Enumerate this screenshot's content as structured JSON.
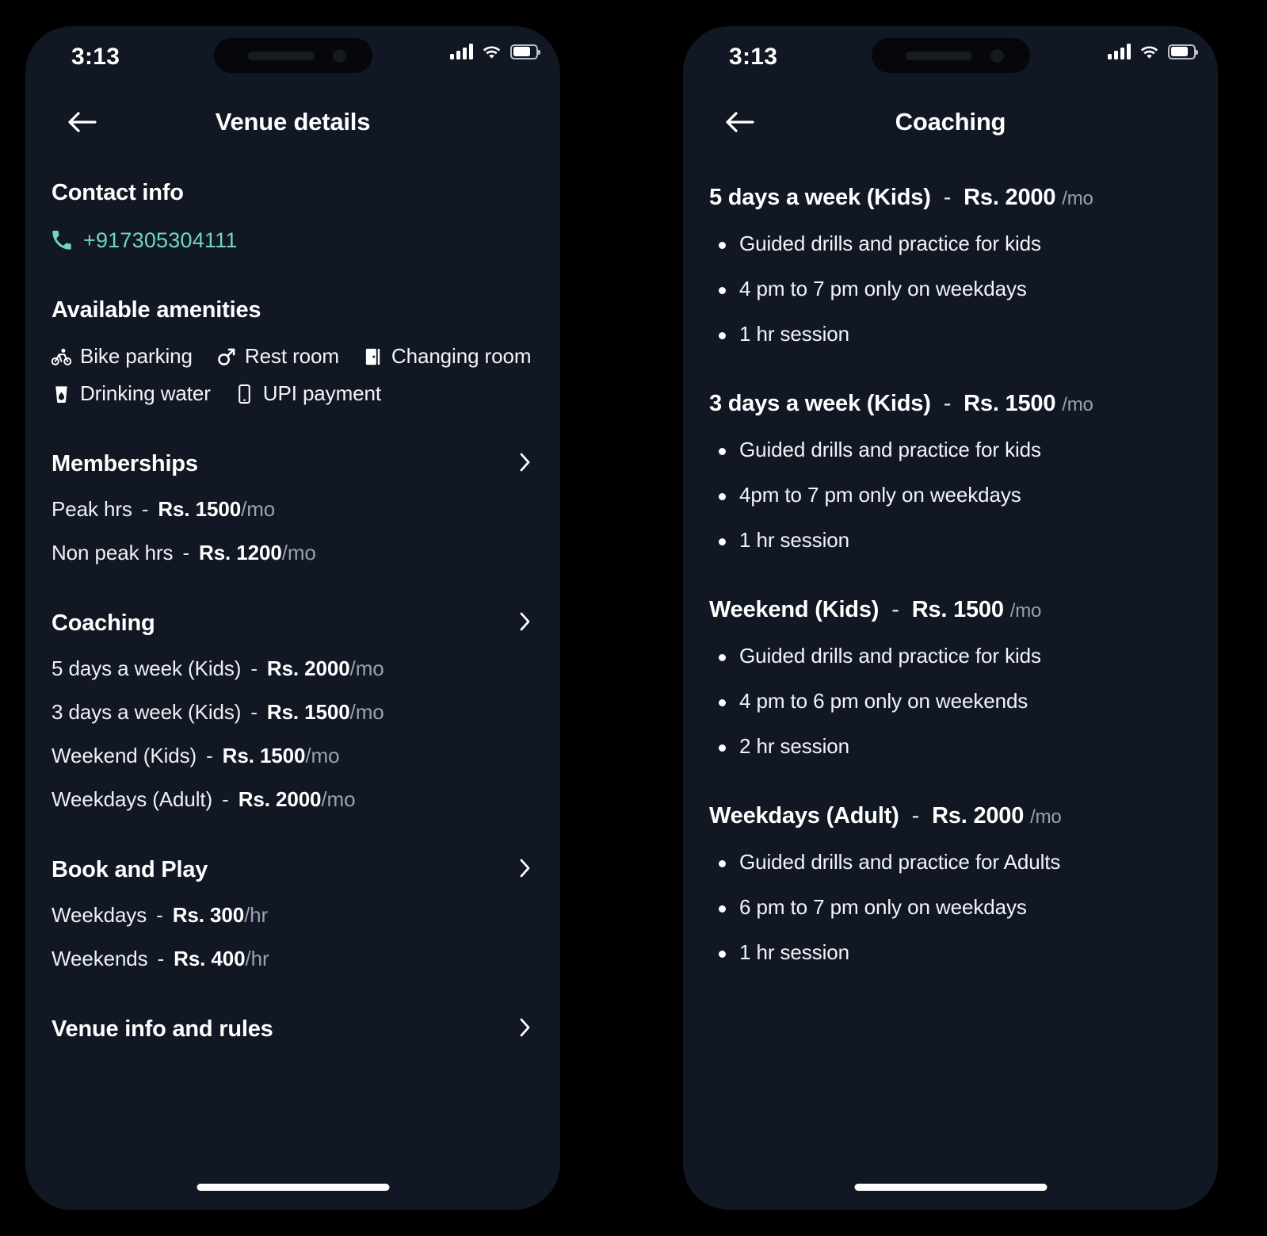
{
  "status_bar": {
    "time": "3:13",
    "signal_icon": "cellular-signal-icon",
    "wifi_icon": "wifi-icon",
    "battery_icon": "battery-icon"
  },
  "colors": {
    "screen_background": "#121724",
    "page_background": "#000000",
    "accent_teal": "#6FD6BD",
    "primary_text": "#FFFFFF",
    "muted_text": "#9AA1B0"
  },
  "venue_screen": {
    "title": "Venue details",
    "back_icon": "back-arrow-icon",
    "contact": {
      "heading": "Contact info",
      "phone_icon": "phone-icon",
      "phone_number": "+917305304111"
    },
    "amenities": {
      "heading": "Available amenities",
      "items": [
        {
          "label": "Bike parking",
          "icon": "bicycle-icon"
        },
        {
          "label": "Rest room",
          "icon": "male-restroom-icon"
        },
        {
          "label": "Changing room",
          "icon": "door-icon"
        },
        {
          "label": "Drinking water",
          "icon": "water-cup-icon"
        },
        {
          "label": "UPI payment",
          "icon": "mobile-phone-icon"
        }
      ]
    },
    "memberships": {
      "heading": "Memberships",
      "chevron_icon": "chevron-right-icon",
      "rows": [
        {
          "label": "Peak hrs",
          "dash": "-",
          "amount": "Rs. 1500",
          "per": "/mo"
        },
        {
          "label": "Non peak hrs",
          "dash": "-",
          "amount": "Rs. 1200",
          "per": "/mo"
        }
      ]
    },
    "coaching": {
      "heading": "Coaching",
      "chevron_icon": "chevron-right-icon",
      "rows": [
        {
          "label": "5 days a week (Kids)",
          "dash": "-",
          "amount": "Rs. 2000",
          "per": "/mo"
        },
        {
          "label": "3 days a week (Kids)",
          "dash": "-",
          "amount": "Rs. 1500",
          "per": "/mo"
        },
        {
          "label": "Weekend (Kids)",
          "dash": "-",
          "amount": "Rs. 1500",
          "per": "/mo"
        },
        {
          "label": "Weekdays (Adult)",
          "dash": "-",
          "amount": "Rs. 2000",
          "per": "/mo"
        }
      ]
    },
    "book_and_play": {
      "heading": "Book and Play",
      "chevron_icon": "chevron-right-icon",
      "rows": [
        {
          "label": "Weekdays",
          "dash": "-",
          "amount": "Rs. 300",
          "per": "/hr"
        },
        {
          "label": "Weekends",
          "dash": "-",
          "amount": "Rs. 400",
          "per": "/hr"
        }
      ]
    },
    "venue_info": {
      "heading": "Venue info and rules",
      "chevron_icon": "chevron-right-icon"
    }
  },
  "coaching_screen": {
    "title": "Coaching",
    "back_icon": "back-arrow-icon",
    "plans": [
      {
        "name": "5 days a week (Kids)",
        "dash": "-",
        "amount": "Rs. 2000",
        "per": "/mo",
        "bullets": [
          "Guided drills and practice for kids",
          "4 pm to 7 pm only on weekdays",
          "1 hr session"
        ]
      },
      {
        "name": "3 days a week (Kids)",
        "dash": "-",
        "amount": "Rs. 1500",
        "per": "/mo",
        "bullets": [
          "Guided drills and practice for kids",
          "4pm to 7 pm only on weekdays",
          "1 hr session"
        ]
      },
      {
        "name": "Weekend (Kids)",
        "dash": "-",
        "amount": "Rs. 1500",
        "per": "/mo",
        "bullets": [
          "Guided drills and practice for kids",
          "4 pm to 6 pm only on weekends",
          "2 hr session"
        ]
      },
      {
        "name": "Weekdays (Adult)",
        "dash": "-",
        "amount": "Rs. 2000",
        "per": "/mo",
        "bullets": [
          "Guided drills and practice for Adults",
          "6 pm to 7 pm only on weekdays",
          "1 hr session"
        ]
      }
    ]
  }
}
